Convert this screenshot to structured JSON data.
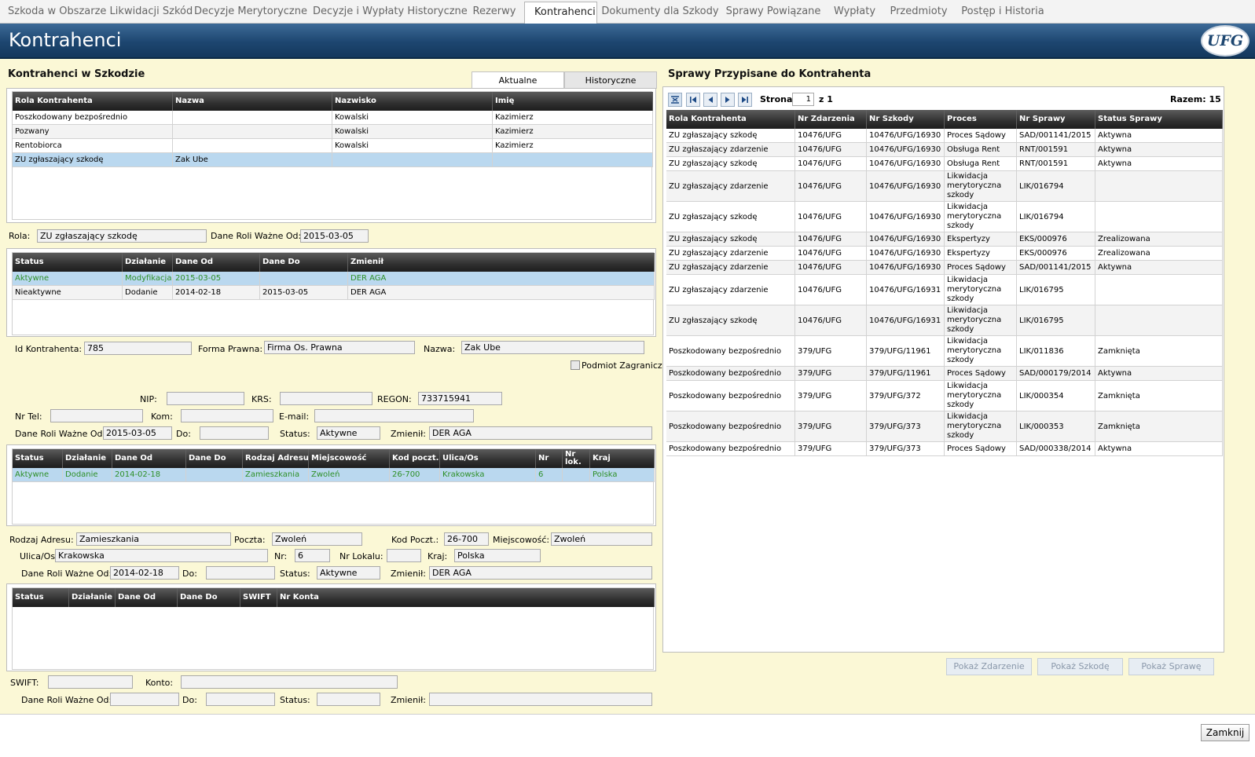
{
  "tabs": [
    {
      "label": "Szkoda w Obszarze Likwidacji Szkód"
    },
    {
      "label": "Decyzje Merytoryczne"
    },
    {
      "label": "Decyzje i Wypłaty Historyczne"
    },
    {
      "label": "Rezerwy"
    },
    {
      "label": "Kontrahenci"
    },
    {
      "label": "Dokumenty dla Szkody"
    },
    {
      "label": "Sprawy Powiązane"
    },
    {
      "label": "Wypłaty"
    },
    {
      "label": "Przedmioty"
    },
    {
      "label": "Postęp i Historia"
    }
  ],
  "header": {
    "title": "Kontrahenci",
    "logo_text": "UFG"
  },
  "left": {
    "title": "Kontrahenci w Szkodzie",
    "subtabs": [
      "Aktualne",
      "Historyczne"
    ],
    "kontrahenci": {
      "columns": [
        "Rola Kontrahenta",
        "Nazwa",
        "Nazwisko",
        "Imię"
      ],
      "rows": [
        [
          "Poszkodowany bezpośrednio",
          "",
          "Kowalski",
          "Kazimierz"
        ],
        [
          "Pozwany",
          "",
          "Kowalski",
          "Kazimierz"
        ],
        [
          "Rentobiorca",
          "",
          "Kowalski",
          "Kazimierz"
        ],
        [
          "ZU zgłaszający szkodę",
          "Zak Ube",
          "",
          ""
        ]
      ]
    },
    "rola": {
      "label": "Rola:",
      "value": "ZU zgłaszający szkodę",
      "wazne_label": "Dane Roli Ważne Od:",
      "wazne_value": "2015-03-05"
    },
    "status_grid": {
      "columns": [
        "Status",
        "Działanie",
        "Dane Od",
        "Dane Do",
        "Zmienił"
      ],
      "rows": [
        [
          "Aktywne",
          "Modyfikacja",
          "2015-03-05",
          "",
          "DER AGA"
        ],
        [
          "Nieaktywne",
          "Dodanie",
          "2014-02-18",
          "2015-03-05",
          "DER AGA"
        ]
      ]
    },
    "details": {
      "id_label": "Id Kontrahenta:",
      "id_value": "785",
      "forma_label": "Forma Prawna:",
      "forma_value": "Firma Os. Prawna",
      "nazwa_label": "Nazwa:",
      "nazwa_value": "Zak Ube",
      "zagraniczny_label": "Podmiot Zagraniczny",
      "nip_label": "NIP:",
      "nip_value": "",
      "krs_label": "KRS:",
      "krs_value": "",
      "regon_label": "REGON:",
      "regon_value": "733715941",
      "tel_label": "Nr Tel:",
      "tel_value": "",
      "kom_label": "Kom:",
      "kom_value": "",
      "email_label": "E-mail:",
      "email_value": "",
      "wazne_label": "Dane Roli Ważne Od:",
      "wazne_value": "2015-03-05",
      "do_label": "Do:",
      "do_value": "",
      "status_label": "Status:",
      "status_value": "Aktywne",
      "zmienil_label": "Zmienił:",
      "zmienil_value": "DER AGA"
    },
    "adres_grid": {
      "columns": [
        "Status",
        "Działanie",
        "Dane Od",
        "Dane Do",
        "Rodzaj Adresu",
        "Miejscowość",
        "Kod poczt.",
        "Ulica/Os",
        "Nr",
        "Nr lok.",
        "Kraj"
      ],
      "rows": [
        [
          "Aktywne",
          "Dodanie",
          "2014-02-18",
          "",
          "Zamieszkania",
          "Zwoleń",
          "26-700",
          "Krakowska",
          "6",
          "",
          "Polska"
        ]
      ]
    },
    "adres": {
      "rodzaj_label": "Rodzaj Adresu:",
      "rodzaj_value": "Zamieszkania",
      "poczta_label": "Poczta:",
      "poczta_value": "Zwoleń",
      "kod_label": "Kod Poczt.:",
      "kod_value": "26-700",
      "miejscowosc_label": "Miejscowość:",
      "miejscowosc_value": "Zwoleń",
      "ulica_label": "Ulica/Os.:",
      "ulica_value": "Krakowska",
      "nr_label": "Nr:",
      "nr_value": "6",
      "lokal_label": "Nr Lokalu:",
      "lokal_value": "",
      "kraj_label": "Kraj:",
      "kraj_value": "Polska",
      "wazne_label": "Dane Roli Ważne Od:",
      "wazne_value": "2014-02-18",
      "do_label": "Do:",
      "do_value": "",
      "status_label": "Status:",
      "status_value": "Aktywne",
      "zmienil_label": "Zmienił:",
      "zmienil_value": "DER AGA"
    },
    "konto_grid": {
      "columns": [
        "Status",
        "Działanie",
        "Dane Od",
        "Dane Do",
        "SWIFT",
        "Nr Konta"
      ],
      "rows": []
    },
    "konto": {
      "swift_label": "SWIFT:",
      "swift_value": "",
      "konto_label": "Konto:",
      "konto_value": "",
      "wazne_label": "Dane Roli Ważne Od:",
      "wazne_value": "",
      "do_label": "Do:",
      "do_value": "",
      "status_label": "Status:",
      "status_value": "",
      "zmienil_label": "Zmienił:",
      "zmienil_value": ""
    }
  },
  "right": {
    "title": "Sprawy Przypisane do Kontrahenta",
    "pager": {
      "strona_label": "Strona",
      "page": "1",
      "of_label": "z 1",
      "total_label": "Razem: 15"
    },
    "columns": [
      "Rola Kontrahenta",
      "Nr Zdarzenia",
      "Nr Szkody",
      "Proces",
      "Nr Sprawy",
      "Status Sprawy"
    ],
    "rows": [
      [
        "ZU zgłaszający szkodę",
        "10476/UFG",
        "10476/UFG/16930",
        "Proces Sądowy",
        "SAD/001141/2015",
        "Aktywna"
      ],
      [
        "ZU zgłaszający zdarzenie",
        "10476/UFG",
        "10476/UFG/16930",
        "Obsługa Rent",
        "RNT/001591",
        "Aktywna"
      ],
      [
        "ZU zgłaszający szkodę",
        "10476/UFG",
        "10476/UFG/16930",
        "Obsługa Rent",
        "RNT/001591",
        "Aktywna"
      ],
      [
        "ZU zgłaszający zdarzenie",
        "10476/UFG",
        "10476/UFG/16930",
        "Likwidacja merytoryczna szkody",
        "LIK/016794",
        ""
      ],
      [
        "ZU zgłaszający szkodę",
        "10476/UFG",
        "10476/UFG/16930",
        "Likwidacja merytoryczna szkody",
        "LIK/016794",
        ""
      ],
      [
        "ZU zgłaszający szkodę",
        "10476/UFG",
        "10476/UFG/16930",
        "Ekspertyzy",
        "EKS/000976",
        "Zrealizowana"
      ],
      [
        "ZU zgłaszający zdarzenie",
        "10476/UFG",
        "10476/UFG/16930",
        "Ekspertyzy",
        "EKS/000976",
        "Zrealizowana"
      ],
      [
        "ZU zgłaszający zdarzenie",
        "10476/UFG",
        "10476/UFG/16930",
        "Proces Sądowy",
        "SAD/001141/2015",
        "Aktywna"
      ],
      [
        "ZU zgłaszający zdarzenie",
        "10476/UFG",
        "10476/UFG/16931",
        "Likwidacja merytoryczna szkody",
        "LIK/016795",
        ""
      ],
      [
        "ZU zgłaszający szkodę",
        "10476/UFG",
        "10476/UFG/16931",
        "Likwidacja merytoryczna szkody",
        "LIK/016795",
        ""
      ],
      [
        "Poszkodowany bezpośrednio",
        "379/UFG",
        "379/UFG/11961",
        "Likwidacja merytoryczna szkody",
        "LIK/011836",
        "Zamknięta"
      ],
      [
        "Poszkodowany bezpośrednio",
        "379/UFG",
        "379/UFG/11961",
        "Proces Sądowy",
        "SAD/000179/2014",
        "Aktywna"
      ],
      [
        "Poszkodowany bezpośrednio",
        "379/UFG",
        "379/UFG/372",
        "Likwidacja merytoryczna szkody",
        "LIK/000354",
        "Zamknięta"
      ],
      [
        "Poszkodowany bezpośrednio",
        "379/UFG",
        "379/UFG/373",
        "Likwidacja merytoryczna szkody",
        "LIK/000353",
        "Zamknięta"
      ],
      [
        "Poszkodowany bezpośrednio",
        "379/UFG",
        "379/UFG/373",
        "Proces Sądowy",
        "SAD/000338/2014",
        "Aktywna"
      ]
    ],
    "buttons": [
      "Pokaż Zdarzenie",
      "Pokaż Szkodę",
      "Pokaż Sprawę"
    ]
  },
  "footer": {
    "close_label": "Zamknij"
  },
  "colors": {
    "header": "#1d4670",
    "panel_bg": "#fbf8d6",
    "selected_row": "#bad8ef",
    "active_text": "#2d8f27"
  }
}
